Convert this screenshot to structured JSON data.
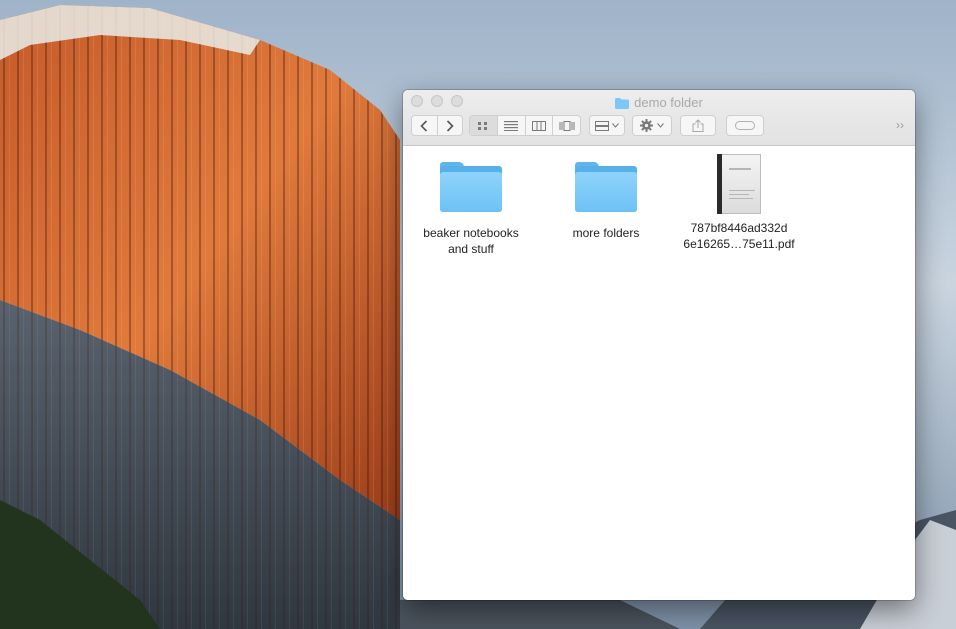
{
  "window": {
    "title": "demo folder",
    "title_icon": "folder-icon",
    "overflow_label": "››"
  },
  "toolbar": {
    "back_icon": "chevron-left-icon",
    "forward_icon": "chevron-right-icon",
    "views": [
      {
        "name": "icon-view",
        "active": true
      },
      {
        "name": "list-view",
        "active": false
      },
      {
        "name": "column-view",
        "active": false
      },
      {
        "name": "cover-flow-view",
        "active": false
      }
    ],
    "arrange_icon": "arrange-icon",
    "action_icon": "gear-icon",
    "share_icon": "share-icon",
    "tags_icon": "tag-icon"
  },
  "items": [
    {
      "kind": "folder",
      "label_line1": "beaker notebooks",
      "label_line2": "and stuff"
    },
    {
      "kind": "folder",
      "label_line1": "more folders",
      "label_line2": ""
    },
    {
      "kind": "pdf",
      "label_line1": "787bf8446ad332d",
      "label_line2": "6e16265…75e11.pdf"
    }
  ],
  "colors": {
    "folder_blue": "#6cc2f5",
    "titlebar": "#e8e8e8"
  }
}
